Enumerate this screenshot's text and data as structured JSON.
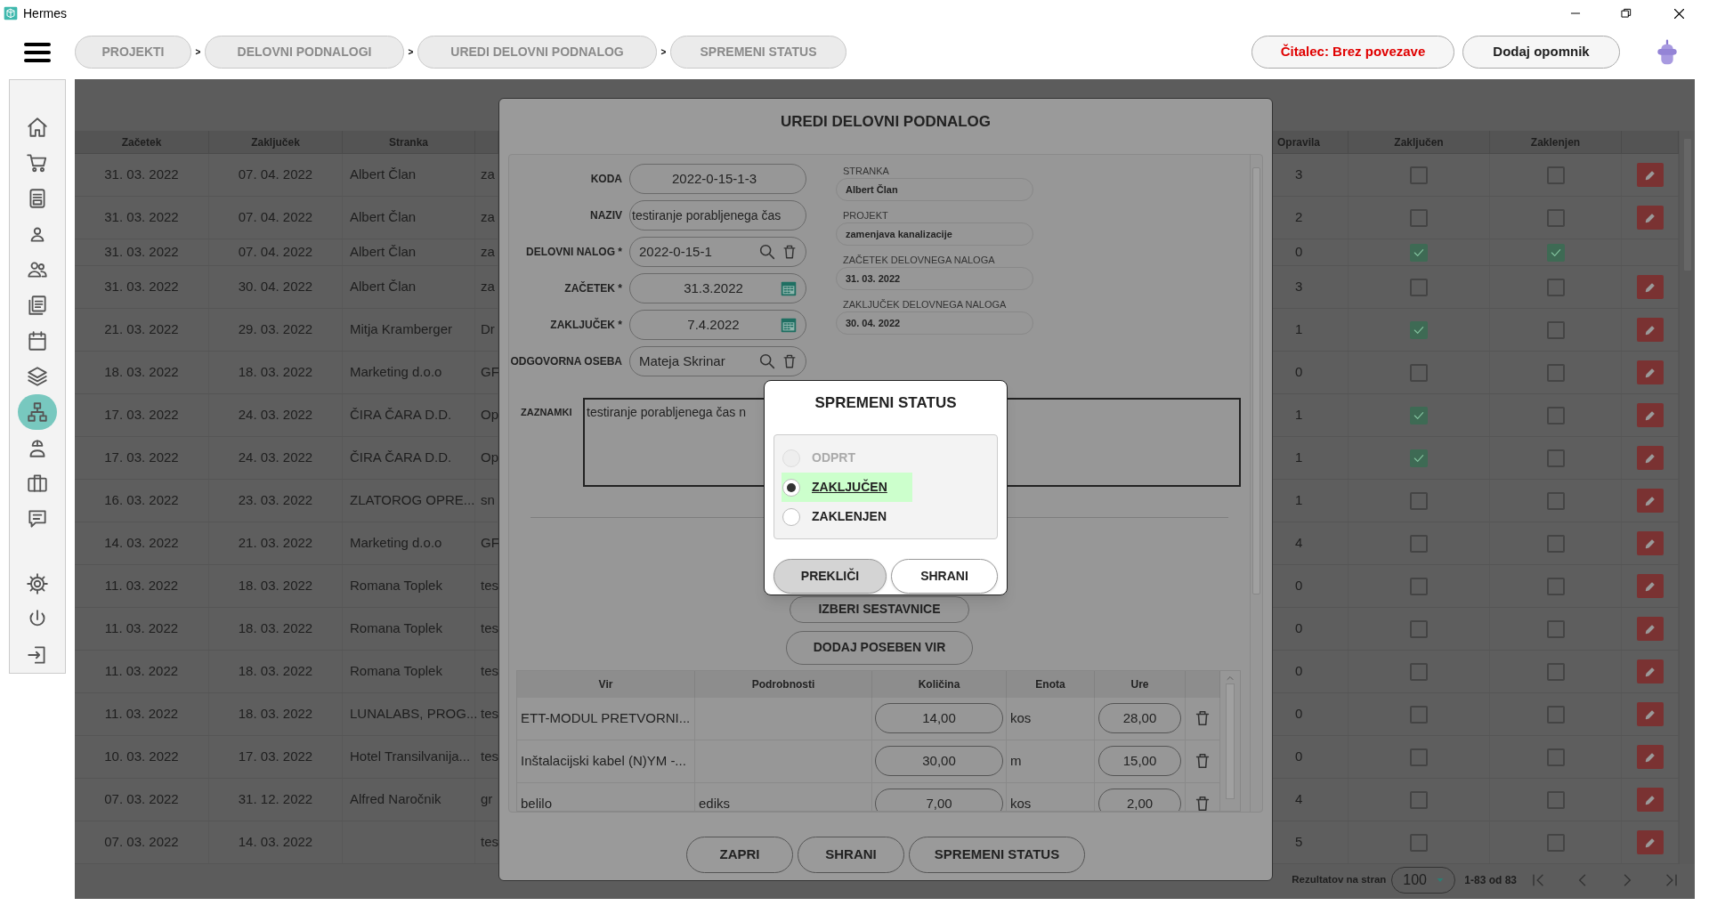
{
  "window": {
    "title": "Hermes"
  },
  "breadcrumbs": [
    "PROJEKTI",
    "DELOVNI PODNALOGI",
    "UREDI DELOVNI PODNALOG",
    "SPREMENI STATUS"
  ],
  "breadcrumb_separators": [
    ">",
    ">",
    ">"
  ],
  "header_buttons": [
    {
      "label": "Čitalec: Brez povezave",
      "kind": "warning"
    },
    {
      "label": "Dodaj opomnik",
      "kind": "normal"
    }
  ],
  "sidebar": {
    "items": [
      {
        "selected": false
      },
      {
        "selected": false
      },
      {
        "selected": false
      },
      {
        "selected": false
      },
      {
        "selected": false
      },
      {
        "selected": false
      },
      {
        "selected": false
      },
      {
        "selected": false
      },
      {
        "selected": true
      },
      {
        "selected": false
      },
      {
        "selected": false
      },
      {
        "selected": false
      }
    ],
    "bottom_items": [
      {
        "selected": false
      },
      {
        "selected": false
      },
      {
        "selected": false
      }
    ]
  },
  "table": {
    "columns": [
      "Začetek",
      "Zaključek",
      "Stranka",
      "Opravila",
      "Zaključen",
      "Zaklenjen"
    ],
    "rows": [
      {
        "start": "31. 03. 2022",
        "end": "07. 04. 2022",
        "client": "Albert Član",
        "column_4": "za",
        "tasks": "3",
        "closed": false,
        "locked": false,
        "edit_button": true
      },
      {
        "start": "31. 03. 2022",
        "end": "07. 04. 2022",
        "client": "Albert Član",
        "column_4": "za",
        "tasks": "2",
        "closed": false,
        "locked": false,
        "edit_button": true
      },
      {
        "start": "31. 03. 2022",
        "end": "07. 04. 2022",
        "client": "Albert Član",
        "column_4": "za",
        "tasks": "0",
        "closed": true,
        "locked": true,
        "edit_button": false
      },
      {
        "start": "31. 03. 2022",
        "end": "30. 04. 2022",
        "client": "Albert Član",
        "column_4": "za",
        "tasks": "3",
        "closed": false,
        "locked": false,
        "edit_button": true
      },
      {
        "start": "21. 03. 2022",
        "end": "29. 03. 2022",
        "client": "Mitja Kramberger",
        "column_4": "Dr",
        "tasks": "1",
        "closed": true,
        "locked": false,
        "edit_button": true
      },
      {
        "start": "18. 03. 2022",
        "end": "18. 03. 2022",
        "client": "Marketing d.o.o",
        "column_4": "GF",
        "tasks": "0",
        "closed": false,
        "locked": false,
        "edit_button": true
      },
      {
        "start": "17. 03. 2022",
        "end": "24. 03. 2022",
        "client": "ČIRA ČARA D.D.",
        "column_4": "Op",
        "tasks": "1",
        "closed": true,
        "locked": false,
        "edit_button": true
      },
      {
        "start": "17. 03. 2022",
        "end": "24. 03. 2022",
        "client": "ČIRA ČARA D.D.",
        "column_4": "Op",
        "tasks": "1",
        "closed": true,
        "locked": false,
        "edit_button": true
      },
      {
        "start": "16. 03. 2022",
        "end": "23. 03. 2022",
        "client": "ZLATOROG OPRE...",
        "column_4": "sn",
        "tasks": "1",
        "closed": false,
        "locked": false,
        "edit_button": true
      },
      {
        "start": "14. 03. 2022",
        "end": "21. 03. 2022",
        "client": "Marketing d.o.o",
        "column_4": "GF",
        "tasks": "4",
        "closed": false,
        "locked": false,
        "edit_button": true
      },
      {
        "start": "11. 03. 2022",
        "end": "18. 03. 2022",
        "client": "Romana Toplek",
        "column_4": "tes",
        "tasks": "0",
        "closed": false,
        "locked": false,
        "edit_button": true
      },
      {
        "start": "11. 03. 2022",
        "end": "18. 03. 2022",
        "client": "Romana Toplek",
        "column_4": "tes",
        "tasks": "0",
        "closed": false,
        "locked": false,
        "edit_button": true
      },
      {
        "start": "11. 03. 2022",
        "end": "18. 03. 2022",
        "client": "Romana Toplek",
        "column_4": "tes",
        "tasks": "0",
        "closed": false,
        "locked": false,
        "edit_button": true
      },
      {
        "start": "11. 03. 2022",
        "end": "18. 03. 2022",
        "client": "LUNALABS, PROG...",
        "column_4": "tes",
        "tasks": "0",
        "closed": false,
        "locked": false,
        "edit_button": true
      },
      {
        "start": "10. 03. 2022",
        "end": "17. 03. 2022",
        "client": "Hotel Transilvanija...",
        "column_4": "tes",
        "tasks": "0",
        "closed": false,
        "locked": false,
        "edit_button": true
      },
      {
        "start": "07. 03. 2022",
        "end": "31. 12. 2022",
        "client": "Alfred Naročnik",
        "column_4": "gr",
        "tasks": "4",
        "closed": false,
        "locked": false,
        "edit_button": true
      },
      {
        "start": "07. 03. 2022",
        "end": "14. 03. 2022",
        "client": "",
        "column_4": "tes",
        "tasks": "5",
        "closed": false,
        "locked": false,
        "edit_button": true
      }
    ]
  },
  "pagination": {
    "label": "Rezultatov na stran",
    "page_size": "100",
    "range": "1-83 od 83"
  },
  "edit_dialog": {
    "title": "UREDI DELOVNI PODNALOG",
    "fields": [
      {
        "label": "KODA",
        "value": "2022-0-15-1-3",
        "kind": "centered"
      },
      {
        "label": "NAZIV",
        "value": "testiranje porabljenega čas",
        "kind": "text"
      },
      {
        "label": "DELOVNI NALOG *",
        "value": "2022-0-15-1",
        "kind": "lookup"
      },
      {
        "label": "ZAČETEK *",
        "value": "31.3.2022",
        "kind": "date"
      },
      {
        "label": "ZAKLJUČEK *",
        "value": "7.4.2022",
        "kind": "date"
      },
      {
        "label": "ODGOVORNA OSEBA",
        "value": "Mateja Skrinar",
        "kind": "lookup"
      }
    ],
    "info": [
      {
        "label": "STRANKA",
        "value": "Albert Član"
      },
      {
        "label": "PROJEKT",
        "value": "zamenjava kanalizacije"
      },
      {
        "label": "ZAČETEK DELOVNEGA NALOGA",
        "value": "31. 03. 2022"
      },
      {
        "label": "ZAKLJUČEK DELOVNEGA NALOGA",
        "value": "30. 04. 2022"
      }
    ],
    "notes": {
      "label": "ZAZNAMKI",
      "value": "testiranje porabljenega čas n"
    },
    "actions": [
      "IZBERI SESTAVNICE",
      "DODAJ POSEBEN VIR"
    ],
    "resources": {
      "columns": [
        "Vir",
        "Podrobnosti",
        "Količina",
        "Enota",
        "Ure"
      ],
      "rows": [
        {
          "source": "ETT-MODUL PRETVORNI...",
          "details": "",
          "quantity": "14,00",
          "unit": "kos",
          "hours": "28,00"
        },
        {
          "source": "Inštalacijski kabel (N)YM -...",
          "details": "",
          "quantity": "30,00",
          "unit": "m",
          "hours": "15,00"
        },
        {
          "source": "belilo",
          "details": "ediks",
          "quantity": "7,00",
          "unit": "kos",
          "hours": "2,00"
        }
      ]
    },
    "buttons": [
      "ZAPRI",
      "SHRANI",
      "SPREMENI STATUS"
    ]
  },
  "status_dialog": {
    "title": "SPREMENI STATUS",
    "options": [
      {
        "label": "ODPRT",
        "selected": false,
        "disabled": true
      },
      {
        "label": "ZAKLJUČEN",
        "selected": true,
        "disabled": false
      },
      {
        "label": "ZAKLENJEN",
        "selected": false,
        "disabled": false
      }
    ],
    "buttons": [
      {
        "label": "PREKLIČI",
        "kind": "cancel"
      },
      {
        "label": "SHRANI",
        "kind": "primary"
      }
    ]
  }
}
